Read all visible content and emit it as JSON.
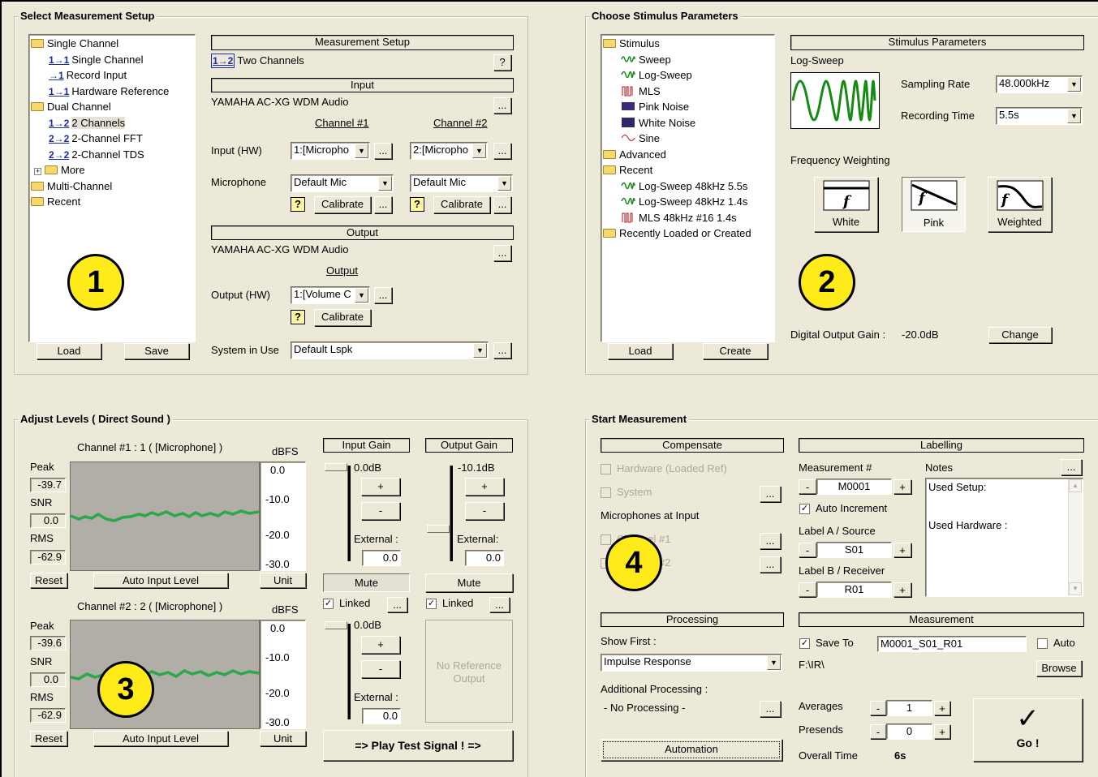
{
  "p1": {
    "title": "Select Measurement Setup",
    "tree": [
      "Single Channel",
      "Single Channel",
      "Record Input",
      "Hardware Reference",
      "Dual Channel",
      "2 Channels",
      "2-Channel FFT",
      "2-Channel TDS",
      "More",
      "Multi-Channel",
      "Recent"
    ],
    "tree_icons": [
      "",
      "1→1",
      "→1",
      "1→1",
      "",
      "1→2",
      "2→2",
      "2→2",
      "",
      "",
      ""
    ],
    "load": "Load",
    "save": "Save",
    "setup_head": "Measurement Setup",
    "setup_value": "Two Channels",
    "setup_icon": "1→2",
    "q": "?",
    "input_head": "Input",
    "input_device": "YAMAHA AC-XG WDM Audio",
    "dots": "...",
    "ch1": "Channel #1",
    "ch2": "Channel #2",
    "input_hw_label": "Input (HW)",
    "input_hw1": "1:[Micropho",
    "input_hw2": "2:[Micropho",
    "mic_label": "Microphone",
    "mic1": "Default Mic",
    "mic2": "Default Mic",
    "calibrate": "Calibrate",
    "output_head": "Output",
    "output_device": "YAMAHA AC-XG WDM Audio",
    "output_col": "Output",
    "output_hw_label": "Output (HW)",
    "output_hw": "1:[Volume C",
    "system_label": "System in Use",
    "system": "Default Lspk",
    "badge": "1"
  },
  "p2": {
    "title": "Choose Stimulus Parameters",
    "tree": [
      "Stimulus",
      "Sweep",
      "Log-Sweep",
      "MLS",
      "Pink Noise",
      "White Noise",
      "Sine",
      "Advanced",
      "Recent",
      "Log-Sweep 48kHz 5.5s",
      "Log-Sweep 48kHz 1.4s",
      "MLS 48kHz #16  1.4s",
      "Recently Loaded or Created"
    ],
    "load": "Load",
    "create": "Create",
    "params_head": "Stimulus Parameters",
    "signal": "Log-Sweep",
    "rate_label": "Sampling Rate",
    "rate": "48.000kHz",
    "rec_label": "Recording Time",
    "rec": "5.5s",
    "fw_label": "Frequency Weighting",
    "w_white": "White",
    "w_pink": "Pink",
    "w_weighted": "Weighted",
    "f": "f",
    "gain_label": "Digital Output Gain :",
    "gain": "-20.0dB",
    "change": "Change",
    "badge": "2"
  },
  "p3": {
    "title": "Adjust Levels ( Direct Sound )",
    "ch1": "Channel #1 : 1 ( [Microphone] )",
    "ch2": "Channel #2 : 2 ( [Microphone] )",
    "dbfs": "dBFS",
    "peak": "Peak",
    "snr": "SNR",
    "rms": "RMS",
    "ch1_peak": "-39.7",
    "ch1_snr": "0.0",
    "ch1_rms": "-62.9",
    "ch2_peak": "-39.6",
    "ch2_snr": "0.0",
    "ch2_rms": "-62.9",
    "scale": [
      "0.0",
      "-10.0",
      "-20.0",
      "-30.0"
    ],
    "reset": "Reset",
    "auto": "Auto Input Level",
    "unit": "Unit",
    "input_gain": "Input Gain",
    "output_gain": "Output Gain",
    "ig1": "0.0dB",
    "og": "-10.1dB",
    "ig2": "0.0dB",
    "plus": "+",
    "minus": "-",
    "ext_label": "External :",
    "ext_label2": "External:",
    "ext1": "0.0",
    "ext_out": "0.0",
    "ext2": "0.0",
    "mute": "Mute",
    "linked": "Linked",
    "noref": "No Reference Output",
    "play": "=>  Play Test Signal !  =>",
    "badge": "3"
  },
  "p4": {
    "title": "Start Measurement",
    "comp_head": "Compensate",
    "hw_ref": "Hardware (Loaded Ref)",
    "system": "System",
    "mic_at_input": "Microphones at Input",
    "mic1": "Channel #1",
    "mic2": "Channel #2",
    "label_head": "Labelling",
    "meas_label": "Measurement #",
    "meas": "M0001",
    "notes": "Notes",
    "notes_text1": "Used Setup:",
    "notes_text2": "Used Hardware :",
    "auto_inc": "Auto Increment",
    "la_label": "Label A / Source",
    "la": "S01",
    "lb_label": "Label B / Receiver",
    "lb": "R01",
    "proc_head": "Processing",
    "show_first": "Show First :",
    "show_val": "Impulse Response",
    "add_proc": "Additional Processing :",
    "no_proc": "- No Processing -",
    "automation": "Automation",
    "meas_head": "Measurement",
    "save_to": "Save To",
    "file": "M0001_S01_R01",
    "auto": "Auto",
    "path": "F:\\IR\\",
    "browse": "Browse",
    "averages": "Averages",
    "avg": "1",
    "presends": "Presends",
    "pre": "0",
    "overall": "Overall Time",
    "overall_val": "6s",
    "go": "Go !",
    "check": "✓",
    "badge": "4"
  }
}
